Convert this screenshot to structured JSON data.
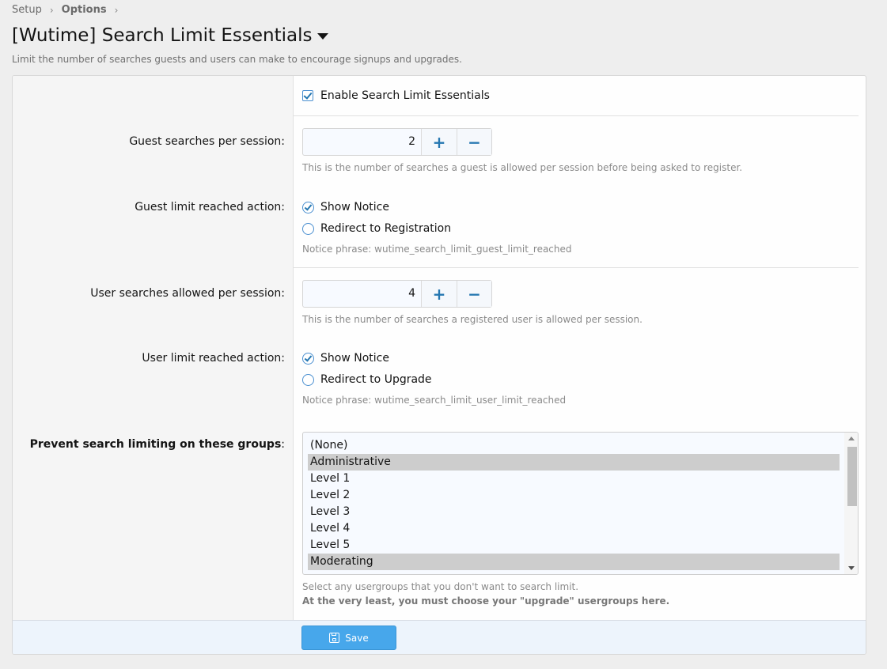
{
  "breadcrumb": {
    "items": [
      "Setup",
      "Options"
    ]
  },
  "page": {
    "title": "[Wutime] Search Limit Essentials",
    "description": "Limit the number of searches guests and users can make to encourage signups and upgrades."
  },
  "form": {
    "enable": {
      "label": "Enable Search Limit Essentials",
      "checked": true
    },
    "guest_searches": {
      "label": "Guest searches per session",
      "value": "2",
      "hint": "This is the number of searches a guest is allowed per session before being asked to register."
    },
    "guest_action": {
      "label": "Guest limit reached action",
      "options": [
        "Show Notice",
        "Redirect to Registration"
      ],
      "selected": "Show Notice",
      "hint": "Notice phrase: wutime_search_limit_guest_limit_reached"
    },
    "user_searches": {
      "label": "User searches allowed per session",
      "value": "4",
      "hint": "This is the number of searches a registered user is allowed per session."
    },
    "user_action": {
      "label": "User limit reached action",
      "options": [
        "Show Notice",
        "Redirect to Upgrade"
      ],
      "selected": "Show Notice",
      "hint": "Notice phrase: wutime_search_limit_user_limit_reached"
    },
    "groups": {
      "label": "Prevent search limiting on these groups",
      "options": [
        "(None)",
        "Administrative",
        "Level 1",
        "Level 2",
        "Level 3",
        "Level 4",
        "Level 5",
        "Moderating"
      ],
      "selected": [
        "Administrative",
        "Moderating"
      ],
      "hint": "Select any usergroups that you don't want to search limit.",
      "hint_bold": "At the very least, you must choose your \"upgrade\" usergroups here."
    },
    "colon": ":",
    "plus": "+",
    "minus": "−"
  },
  "footer": {
    "save_label": "Save"
  }
}
